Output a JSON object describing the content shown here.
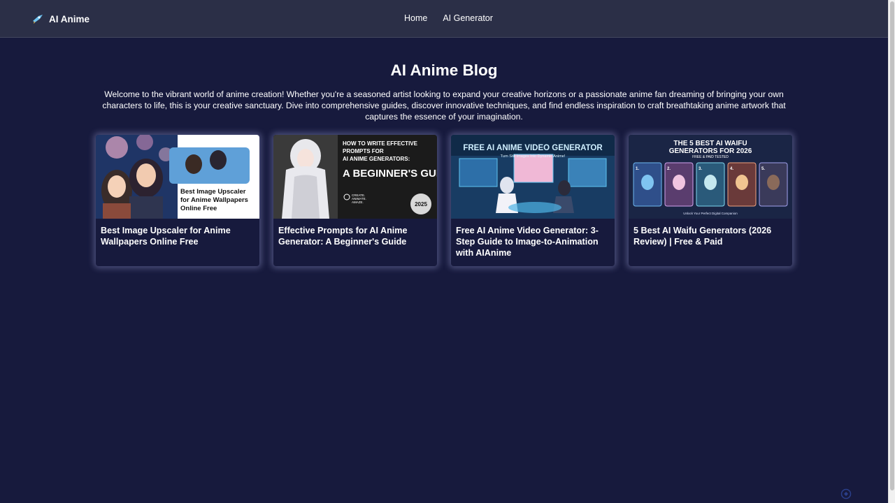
{
  "header": {
    "brand": "AI Anime",
    "nav": [
      "Home",
      "AI Generator"
    ]
  },
  "page": {
    "title": "AI Anime Blog",
    "intro": "Welcome to the vibrant world of anime creation! Whether you're a seasoned artist looking to expand your creative horizons or a passionate anime fan dreaming of bringing your own characters to life, this is your creative sanctuary. Dive into comprehensive guides, discover innovative techniques, and find endless inspiration to craft breathtaking anime artwork that captures the essence of your imagination."
  },
  "posts": [
    {
      "title": "Best Image Upscaler for Anime Wallpapers Online Free",
      "thumb_text": "Best Image Upscaler for Anime Wallpapers Online Free"
    },
    {
      "title": "Effective Prompts for AI Anime Generator: A Beginner's Guide",
      "thumb_text": [
        "HOW TO WRITE EFFECTIVE",
        "PROMPTS FOR",
        "AI ANIME GENERATORS:",
        "A BEGINNER'S GUIDE",
        "2025",
        "CREATE.",
        "ANIMATE.",
        "AMAZE."
      ]
    },
    {
      "title": "Free AI Anime Video Generator: 3-Step Guide to Image-to-Animation with AIAnime",
      "thumb_text": [
        "FREE AI ANIME VIDEO GENERATOR",
        "Turn Still Images into Dynamic Anime!"
      ]
    },
    {
      "title": "5 Best AI Waifu Generators (2026 Review) | Free & Paid",
      "thumb_text": [
        "THE 5 BEST AI WAIFU",
        "GENERATORS FOR 2026",
        "FREE & PAID TESTED",
        "Unlock Your Perfect Digital Companion",
        "1.",
        "2.",
        "3.",
        "4.",
        "5."
      ]
    }
  ],
  "colors": {
    "background": "#171a3d",
    "header": "#2b2f47",
    "text": "#ffffff",
    "card_glow": "#bec4ff"
  }
}
